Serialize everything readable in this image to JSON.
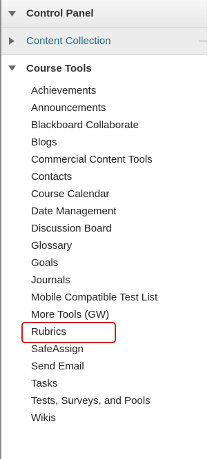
{
  "control_panel": {
    "label": "Control Panel",
    "icon": "triangle-down-icon"
  },
  "content_collection": {
    "label": "Content Collection",
    "icon": "triangle-right-icon"
  },
  "course_tools": {
    "label": "Course Tools",
    "icon": "triangle-down-icon",
    "items": [
      {
        "label": "Achievements"
      },
      {
        "label": "Announcements"
      },
      {
        "label": "Blackboard Collaborate"
      },
      {
        "label": "Blogs"
      },
      {
        "label": "Commercial Content Tools"
      },
      {
        "label": "Contacts"
      },
      {
        "label": "Course Calendar"
      },
      {
        "label": "Date Management"
      },
      {
        "label": "Discussion Board"
      },
      {
        "label": "Glossary"
      },
      {
        "label": "Goals"
      },
      {
        "label": "Journals"
      },
      {
        "label": "Mobile Compatible Test List"
      },
      {
        "label": "More Tools (GW)",
        "highlighted": true
      },
      {
        "label": "Rubrics"
      },
      {
        "label": "SafeAssign"
      },
      {
        "label": "Send Email"
      },
      {
        "label": "Tasks"
      },
      {
        "label": "Tests, Surveys, and Pools"
      },
      {
        "label": "Wikis"
      }
    ]
  },
  "colors": {
    "link": "#2a6a8a",
    "highlight_border": "#d21a1a",
    "text": "#222222"
  }
}
